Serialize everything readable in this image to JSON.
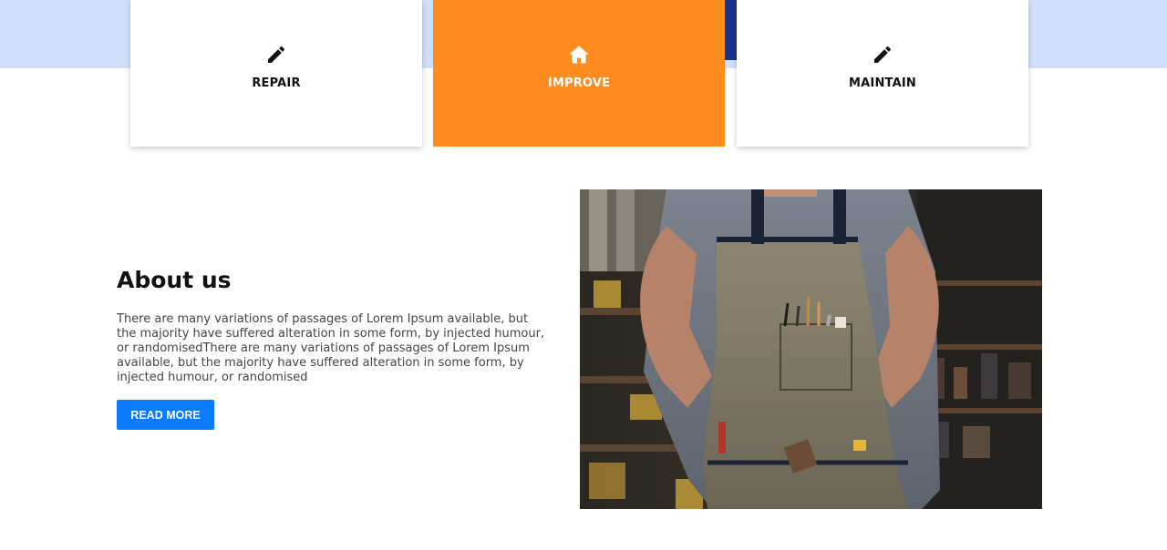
{
  "services": [
    {
      "label": "REPAIR",
      "icon": "pencil-icon",
      "active": false
    },
    {
      "label": "IMPROVE",
      "icon": "home-icon",
      "active": true
    },
    {
      "label": "MAINTAIN",
      "icon": "pencil-icon",
      "active": false
    }
  ],
  "about": {
    "title": "About us",
    "text": "There are many variations of passages of Lorem Ipsum available, but the majority have suffered alteration in some form, by injected humour, or randomisedThere are many variations of passages of Lorem Ipsum available, but the majority have suffered alteration in some form, by injected humour, or randomised",
    "button_label": "READ MORE"
  },
  "colors": {
    "accent_orange": "#ff8c1f",
    "hero_band": "#cfe0fb",
    "button_blue": "#0a7cff"
  },
  "photo": {
    "subject": "craftsman-in-apron-image"
  }
}
